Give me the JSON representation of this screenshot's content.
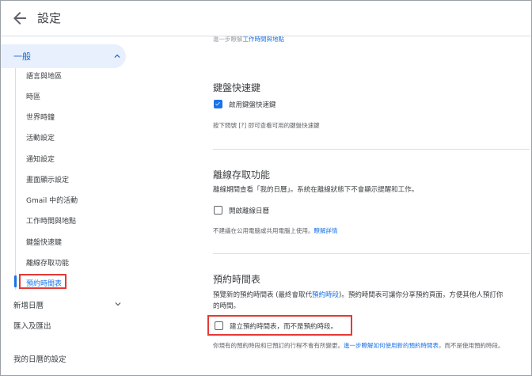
{
  "header": {
    "title": "設定"
  },
  "sidebar": {
    "general_label": "一般",
    "items": [
      "語言與地區",
      "時區",
      "世界時鐘",
      "活動設定",
      "通知設定",
      "畫面顯示設定",
      "Gmail 中的活動",
      "工作時間與地點",
      "鍵盤快速鍵",
      "離線存取功能",
      "預約時間表"
    ],
    "add_calendar": "新增日曆",
    "import_export": "匯入及匯出",
    "my_calendars": "我的日曆的設定"
  },
  "main": {
    "top_partial": {
      "prefix": "進一步瞭解",
      "link": "工作時間與地點"
    },
    "keyboard": {
      "heading": "鍵盤快速鍵",
      "checkbox_label": "啟用鍵盤快速鍵",
      "checked": true,
      "hint": "按下問號 [?] 即可查看可用的鍵盤快速鍵"
    },
    "offline": {
      "heading": "離線存取功能",
      "desc": "離線期間查看「我的日曆」。系統在離線狀態下不會顯示提醒和工作。",
      "checkbox_label": "開啟離線日曆",
      "checked": false,
      "note": "不建議在公用電腦或共用電腦上使用。",
      "note_link": "瞭解詳情"
    },
    "booking": {
      "heading": "預約時間表",
      "desc_line1_a": "預覽新的預約時間表 (最終會取代",
      "desc_line1_link": "預約時段",
      "desc_line1_b": ")。預約時間表可讓你分享預約頁面，方便其他人預訂你",
      "desc_line2": "的時間。",
      "checkbox_label": "建立預約時間表，而不是預約時段。",
      "checked": false,
      "note_a": "你現有的預約時段和已預訂的行程不會有所變更。",
      "note_link": "進一步瞭解如何使用新的預約時間表",
      "note_b": "，而不是使用預約時段。"
    }
  },
  "colors": {
    "accent": "#1a73e8",
    "highlight": "#e53935",
    "selected_bg": "#e8f0fe"
  }
}
